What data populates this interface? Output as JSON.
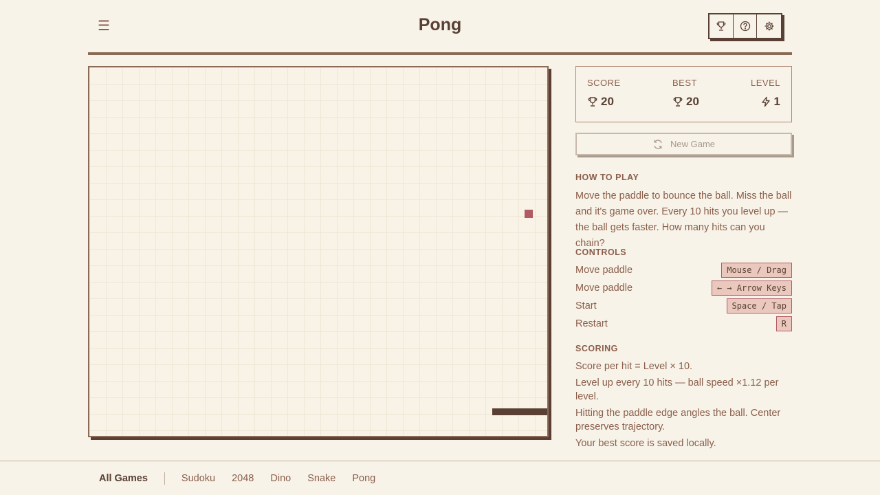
{
  "header": {
    "menu_icon": "☰",
    "title": "Pong",
    "icons": [
      "trophy-icon",
      "help-icon",
      "gear-icon"
    ]
  },
  "stats": {
    "score_label": "SCORE",
    "score_value": "20",
    "best_label": "BEST",
    "best_value": "20",
    "level_label": "LEVEL",
    "level_value": "1"
  },
  "new_game_label": "New Game",
  "how_to_play": {
    "heading": "HOW TO PLAY",
    "text": "Move the paddle to bounce the ball. Miss the ball and it's game over. Every 10 hits you level up — the ball gets faster. How many hits can you chain?"
  },
  "controls": {
    "heading": "CONTROLS",
    "rows": [
      {
        "action": "Move paddle",
        "key": "Mouse / Drag"
      },
      {
        "action": "Move paddle",
        "key": "← → Arrow Keys"
      },
      {
        "action": "Start",
        "key": "Space / Tap"
      },
      {
        "action": "Restart",
        "key": "R"
      }
    ]
  },
  "scoring": {
    "heading": "SCORING",
    "lines": [
      "Score per hit = Level × 10.",
      "Level up every 10 hits — ball speed ×1.12 per level.",
      "Hitting the paddle edge angles the ball. Center preserves trajectory.",
      "Your best score is saved locally."
    ]
  },
  "footer": {
    "all_games": "All Games",
    "links": [
      "Sudoku",
      "2048",
      "Dino",
      "Snake",
      "Pong"
    ]
  },
  "colors": {
    "background": "#f7f3e8",
    "dark": "#5a4034",
    "text": "#8b5e4b",
    "ball": "#b25a62",
    "key_bg": "#eac8bd"
  }
}
